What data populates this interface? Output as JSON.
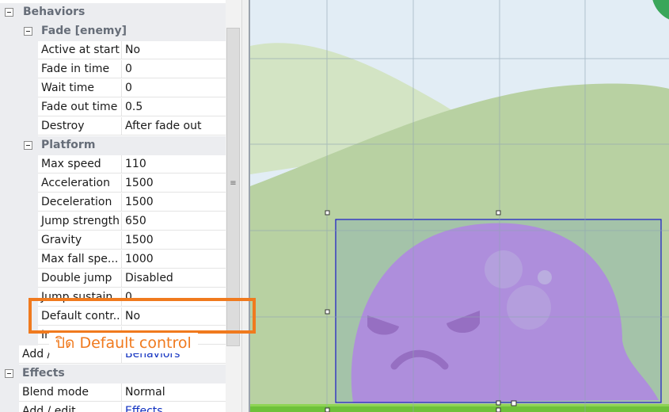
{
  "properties": {
    "behaviors_header": "Behaviors",
    "fade": {
      "header": "Fade [enemy]",
      "rows": [
        {
          "name": "Active at start",
          "value": "No"
        },
        {
          "name": "Fade in time",
          "value": "0"
        },
        {
          "name": "Wait time",
          "value": "0"
        },
        {
          "name": "Fade out time",
          "value": "0.5"
        },
        {
          "name": "Destroy",
          "value": "After fade out"
        }
      ]
    },
    "platform": {
      "header": "Platform",
      "rows": [
        {
          "name": "Max speed",
          "value": "110"
        },
        {
          "name": "Acceleration",
          "value": "1500"
        },
        {
          "name": "Deceleration",
          "value": "1500"
        },
        {
          "name": "Jump strength",
          "value": "650"
        },
        {
          "name": "Gravity",
          "value": "1500"
        },
        {
          "name": "Max fall spe...",
          "value": "1000"
        },
        {
          "name": "Double jump",
          "value": "Disabled"
        },
        {
          "name": "Jump sustain",
          "value": "0"
        },
        {
          "name": "Default contr...",
          "value": "No"
        },
        {
          "name": "In",
          "value": ""
        }
      ]
    },
    "add_edit_behaviors": {
      "name": "Add /",
      "value": "Behaviors"
    },
    "effects_header": "Effects",
    "effects": {
      "rows": [
        {
          "name": "Blend mode",
          "value": "Normal"
        },
        {
          "name": "Add / edit",
          "value": "Effects"
        }
      ]
    }
  },
  "annotation": {
    "text": "ปิด Default control",
    "color": "#f07a1e"
  },
  "canvas": {
    "sky_color": "#e2edf5",
    "hill_back_color": "#d3e4c4",
    "hill_front_color": "#b8d1a2",
    "enemy_color": "#c880f0",
    "selection_color": "#1a1ac8"
  }
}
